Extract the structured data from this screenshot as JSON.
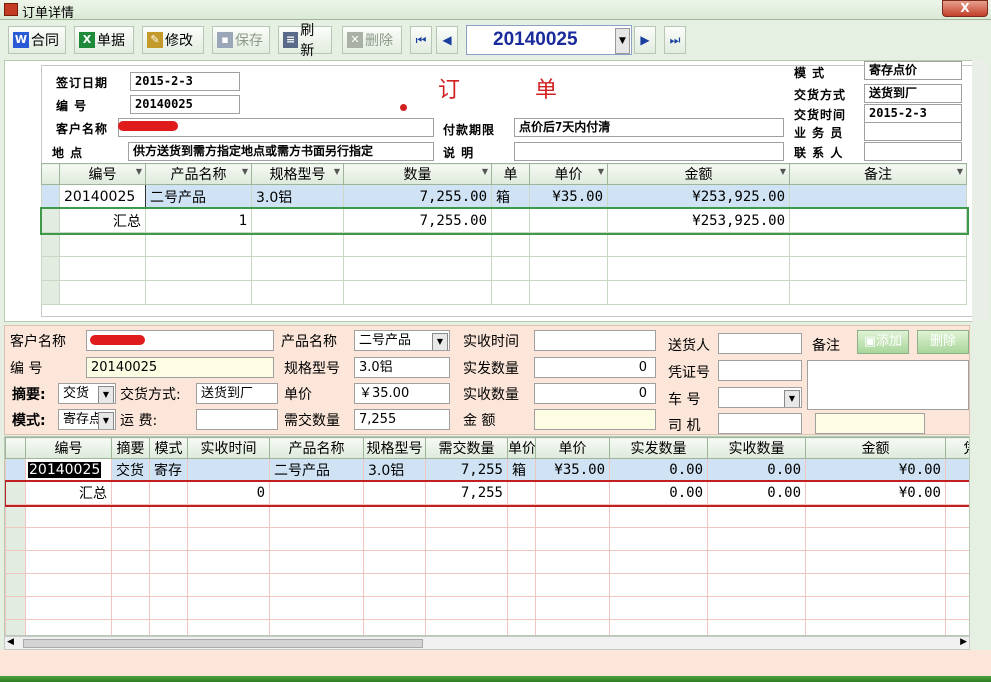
{
  "window": {
    "title": "订单详情",
    "close": "X"
  },
  "toolbar": {
    "contract": "合同",
    "doc": "单据",
    "edit": "修改",
    "save": "保存",
    "refresh": "刷新",
    "delete": "删除",
    "record": "20140025"
  },
  "header": {
    "title": "订   单",
    "sign_date_label": "签订日期",
    "sign_date": "2015-2-3",
    "number_label": "编    号",
    "number": "20140025",
    "customer_label": "客户名称",
    "customer": "",
    "payterm_label": "付款期限",
    "payterm": "点价后7天内付清",
    "address_label": "地    点",
    "address": "供方送货到需方指定地点或需方书面另行指定",
    "note_label": "说    明",
    "note": "",
    "mode_label": "模    式",
    "mode": "寄存点价",
    "delivery_method_label": "交货方式",
    "delivery_method": "送货到厂",
    "delivery_time_label": "交货时间",
    "delivery_time": "2015-2-3",
    "salesman_label": "业 务 员",
    "salesman": "",
    "contact_label": "联 系 人",
    "contact": ""
  },
  "grid1": {
    "columns": [
      "编号",
      "产品名称",
      "规格型号",
      "数量",
      "单",
      "单价",
      "金额",
      "备注"
    ],
    "rows": [
      {
        "no": "20140025",
        "product": "二号产品",
        "spec": "3.0铝",
        "qty": "7,255.00",
        "unit": "箱",
        "price": "¥35.00",
        "amount": "¥253,925.00",
        "remark": ""
      }
    ],
    "summary": {
      "label": "汇总",
      "count": "1",
      "qty": "7,255.00",
      "amount": "¥253,925.00"
    }
  },
  "lower": {
    "customer_label": "客户名称",
    "customer": "",
    "product_label": "产品名称",
    "product": "二号产品",
    "recv_time_label": "实收时间",
    "recv_time": "",
    "sender_label": "送货人",
    "sender": "",
    "remark_label": "备注",
    "add_label": "添加",
    "del_label": "删除",
    "number_label": "编    号",
    "number": "20140025",
    "spec_label": "规格型号",
    "spec": "3.0铝",
    "sent_qty_label": "实发数量",
    "sent_qty": "0",
    "voucher_label": "凭证号",
    "voucher": "",
    "summary_label": "摘要:",
    "summary": "交货",
    "delivery_method_label": "交货方式:",
    "delivery_method": "送货到厂",
    "price_label": "单价",
    "price": "￥35.00",
    "recv_qty_label": "实收数量",
    "recv_qty": "0",
    "car_label": "车    号",
    "car": "",
    "mode_label": "模式:",
    "mode": "寄存点",
    "freight_label": "运      费:",
    "freight": "",
    "need_qty_label": "需交数量",
    "need_qty": "7,255",
    "amount_label": "金    额",
    "amount": "",
    "driver_label": "司    机",
    "driver": ""
  },
  "grid2": {
    "columns": [
      "编号",
      "摘要",
      "模式",
      "实收时间",
      "产品名称",
      "规格型号",
      "需交数量",
      "单价",
      "单价",
      "实发数量",
      "实收数量",
      "金额",
      "凭"
    ],
    "rows": [
      {
        "no": "20140025",
        "summary": "交货",
        "mode": "寄存",
        "recv_time": "",
        "product": "二号产品",
        "spec": "3.0铝",
        "need": "7,255",
        "unit": "箱",
        "price": "¥35.00",
        "sent": "0.00",
        "recv": "0.00",
        "amount": "¥0.00"
      }
    ],
    "total": {
      "label": "汇总",
      "count": "0",
      "need": "7,255",
      "sent": "0.00",
      "recv": "0.00",
      "amount": "¥0.00"
    }
  }
}
